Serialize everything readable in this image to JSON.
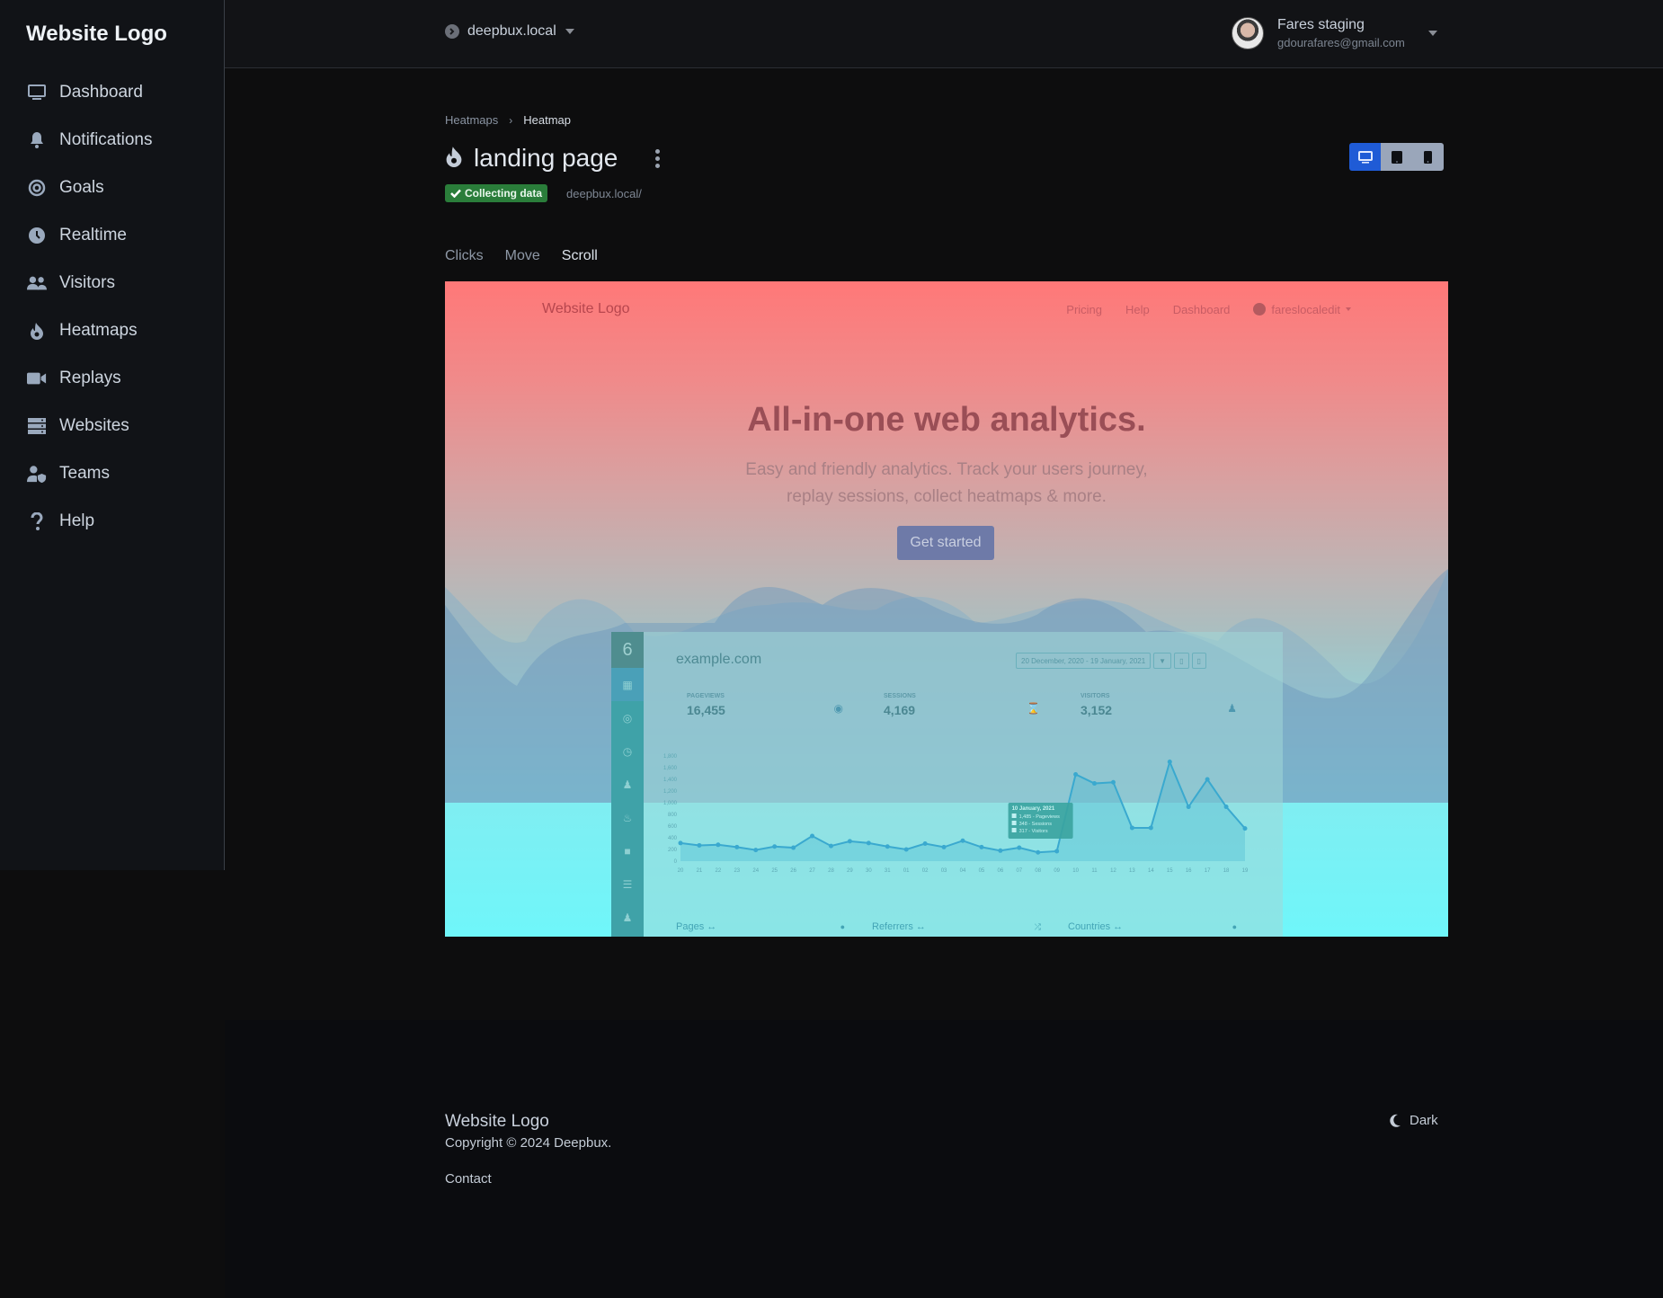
{
  "sidebar": {
    "brand": "Website Logo",
    "items": [
      {
        "label": "Dashboard",
        "icon": "monitor-icon"
      },
      {
        "label": "Notifications",
        "icon": "bell-icon"
      },
      {
        "label": "Goals",
        "icon": "target-icon"
      },
      {
        "label": "Realtime",
        "icon": "clock-icon"
      },
      {
        "label": "Visitors",
        "icon": "users-icon"
      },
      {
        "label": "Heatmaps",
        "icon": "fire-icon"
      },
      {
        "label": "Replays",
        "icon": "video-icon"
      },
      {
        "label": "Websites",
        "icon": "server-icon"
      },
      {
        "label": "Teams",
        "icon": "user-shield-icon"
      },
      {
        "label": "Help",
        "icon": "question-icon"
      }
    ]
  },
  "topbar": {
    "site": "deepbux.local",
    "user_name": "Fares staging",
    "user_email": "gdourafares@gmail.com"
  },
  "breadcrumb": {
    "parent": "Heatmaps",
    "current": "Heatmap"
  },
  "page": {
    "title": "landing page",
    "status": "Collecting data",
    "url": "deepbux.local/",
    "status_color": "#2a7d3a"
  },
  "device_toggle": [
    {
      "name": "desktop",
      "active": true
    },
    {
      "name": "tablet",
      "active": false
    },
    {
      "name": "mobile",
      "active": false
    }
  ],
  "tabs": [
    {
      "label": "Clicks",
      "active": false
    },
    {
      "label": "Move",
      "active": false
    },
    {
      "label": "Scroll",
      "active": true
    }
  ],
  "preview": {
    "nav_logo": "Website Logo",
    "nav_links": [
      "Pricing",
      "Help",
      "Dashboard"
    ],
    "nav_user": "fareslocaledit",
    "hero_title": "All-in-one web analytics.",
    "hero_subtitle": "Easy and friendly analytics. Track your users journey, replay sessions, collect heatmaps & more.",
    "hero_button": "Get started",
    "dashboard": {
      "sidebar_number": "6",
      "site": "example.com",
      "date_range": "20 December, 2020 - 19 January, 2021",
      "stats": [
        {
          "label": "PAGEVIEWS",
          "value": "16,455"
        },
        {
          "label": "SESSIONS",
          "value": "4,169"
        },
        {
          "label": "VISITORS",
          "value": "3,152"
        }
      ],
      "chart": {
        "y_ticks": [
          "0",
          "200",
          "400",
          "600",
          "800",
          "1,000",
          "1,200",
          "1,400",
          "1,600",
          "1,800"
        ],
        "x_labels": [
          "20",
          "21",
          "22",
          "23",
          "24",
          "25",
          "26",
          "27",
          "28",
          "29",
          "30",
          "31",
          "01",
          "02",
          "03",
          "04",
          "05",
          "06",
          "07",
          "08",
          "09",
          "10",
          "11",
          "12",
          "13",
          "14",
          "15",
          "16",
          "17",
          "18",
          "19"
        ],
        "values": [
          310,
          270,
          280,
          240,
          190,
          250,
          230,
          430,
          260,
          340,
          310,
          250,
          200,
          300,
          240,
          350,
          240,
          180,
          230,
          150,
          170,
          1485,
          1330,
          1350,
          570,
          570,
          1700,
          930,
          1400,
          930,
          560
        ],
        "tooltip": {
          "date": "10 January, 2021",
          "lines": [
            "1,485 - Pageviews",
            "348 - Sessions",
            "317 - Visitors"
          ]
        }
      },
      "cards": [
        "Pages",
        "Referrers",
        "Countries"
      ]
    },
    "scroll_gradient": {
      "top": "#ff7878",
      "middle": "#bdb5b5",
      "bottom": "#6ff6fa"
    }
  },
  "footer": {
    "logo": "Website Logo",
    "copyright": "Copyright © 2024 Deepbux.",
    "contact": "Contact",
    "theme": "Dark"
  }
}
